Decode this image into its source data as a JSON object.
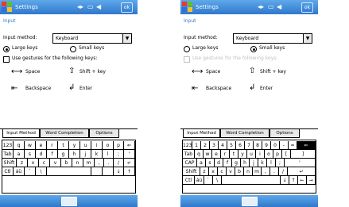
{
  "screens": [
    {
      "app_title": "Settings",
      "status": {
        "signal": "◂▸",
        "battery": "▭",
        "volume": "◀"
      },
      "ok_label": "ok",
      "heading": "Input",
      "input_method_label": "Input method:",
      "input_method_value": "Keyboard",
      "large_keys_label": "Large keys",
      "small_keys_label": "Small keys",
      "gestures_label": "Use gestures for the following keys:",
      "space_label": "Space",
      "shift_key_label": "Shift + key",
      "backspace_label": "Backspace",
      "enter_label": "Enter",
      "tabs": [
        "Input Method",
        "Word Completion",
        "Options"
      ],
      "keyboard_rows": [
        [
          "123",
          "q",
          "w",
          "e",
          "r",
          "t",
          "y",
          "u",
          "i",
          "o",
          "p",
          "⇐"
        ],
        [
          "Tab",
          "a",
          "s",
          "d",
          "f",
          "g",
          "h",
          "j",
          "k",
          "l",
          ";",
          "'"
        ],
        [
          "Shift",
          "z",
          "x",
          "c",
          "v",
          "b",
          "n",
          "m",
          ",",
          ".",
          "/",
          "↵"
        ],
        [
          "Ctl",
          "áü",
          "`",
          "\\",
          "",
          "",
          "",
          "↓",
          "↑",
          "←",
          "→"
        ]
      ]
    },
    {
      "app_title": "Settings",
      "status": {
        "signal": "◂▸",
        "battery": "▭",
        "volume": "◀"
      },
      "ok_label": "ok",
      "heading": "Input",
      "input_method_label": "Input method:",
      "input_method_value": "Keyboard",
      "large_keys_label": "Large keys",
      "small_keys_label": "Small keys",
      "gestures_label": "Use gestures for the following keys:",
      "space_label": "Space",
      "shift_key_label": "Shift + key",
      "backspace_label": "Backspace",
      "enter_label": "Enter",
      "tabs": [
        "Input Method",
        "Word Completion",
        "Options"
      ],
      "keyboard_rows": [
        [
          "123",
          "1",
          "2",
          "3",
          "4",
          "5",
          "6",
          "7",
          "8",
          "9",
          "0",
          "-",
          "=",
          "⇐"
        ],
        [
          "Tab",
          "q",
          "w",
          "e",
          "r",
          "t",
          "y",
          "u",
          "i",
          "o",
          "p",
          "[",
          "]"
        ],
        [
          "CAP",
          "a",
          "s",
          "d",
          "f",
          "g",
          "h",
          "j",
          "k",
          "l",
          ";",
          "'"
        ],
        [
          "Shift",
          "z",
          "x",
          "c",
          "v",
          "b",
          "n",
          "m",
          ",",
          ".",
          "/",
          "↵"
        ],
        [
          "Ctl",
          "áü",
          "`",
          "\\",
          "",
          "↓",
          "↑",
          "←",
          "→"
        ]
      ]
    }
  ],
  "colors": {
    "title_bar": "#2f78cc",
    "link": "#2f78cc"
  },
  "icons": [
    "windows-start-icon",
    "signal-icon",
    "battery-icon",
    "volume-icon",
    "keyboard-icon"
  ]
}
